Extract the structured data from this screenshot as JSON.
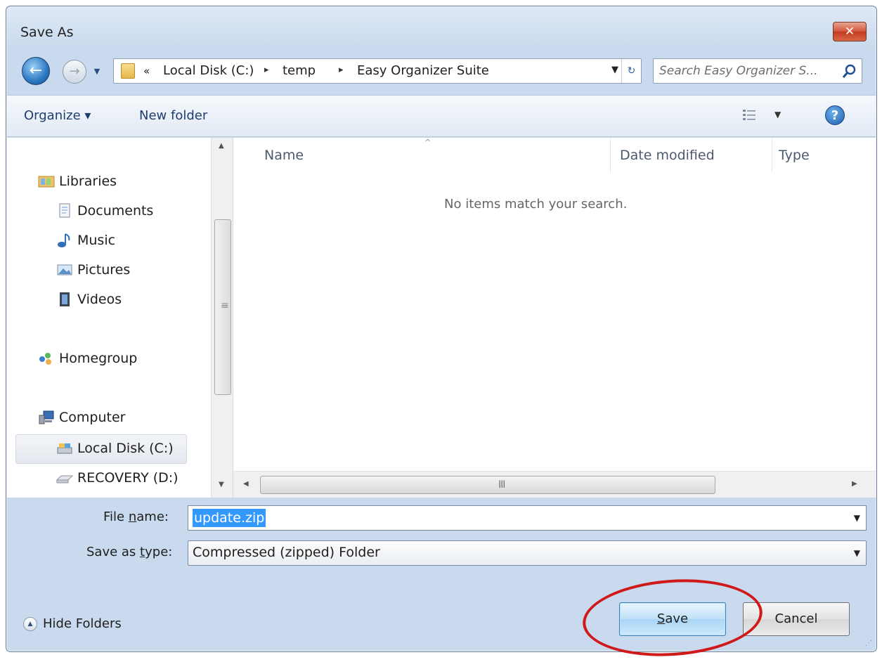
{
  "window": {
    "title": "Save As",
    "close_label": "✕"
  },
  "nav": {
    "back": "←",
    "forward": "→",
    "recent": "▼"
  },
  "address": {
    "overflow": "«",
    "crumbs": [
      "Local Disk (C:)",
      "temp",
      "Easy Organizer Suite"
    ],
    "separator": "▸",
    "dropdown": "▼",
    "refresh": "↻"
  },
  "search": {
    "placeholder": "Search Easy Organizer S..."
  },
  "toolbar": {
    "organize_label": "Organize ▾",
    "new_folder_label": "New folder",
    "view_drop": "▼",
    "help": "?"
  },
  "sidebar": {
    "items": [
      {
        "label": "Libraries",
        "icon": "libraries-icon"
      },
      {
        "label": "Documents",
        "icon": "documents-icon"
      },
      {
        "label": "Music",
        "icon": "music-icon"
      },
      {
        "label": "Pictures",
        "icon": "pictures-icon"
      },
      {
        "label": "Videos",
        "icon": "videos-icon"
      },
      {
        "label": "Homegroup",
        "icon": "homegroup-icon"
      },
      {
        "label": "Computer",
        "icon": "computer-icon"
      },
      {
        "label": "Local Disk (C:)",
        "icon": "local-disk-icon"
      },
      {
        "label": "RECOVERY (D:)",
        "icon": "drive-icon"
      }
    ],
    "selected_index": 7
  },
  "file_list": {
    "columns": [
      "Name",
      "Date modified",
      "Type"
    ],
    "sort_indicator": "^",
    "empty_message": "No items match your search."
  },
  "scroll": {
    "up": "▲",
    "down": "▼",
    "left": "◀",
    "right": "▶",
    "grip_v": "≡",
    "grip_h": "III"
  },
  "form": {
    "file_name_label_pre": "File ",
    "file_name_label_u": "n",
    "file_name_label_post": "ame:",
    "file_name_value": "update.zip",
    "save_type_label_pre": "Save as ",
    "save_type_label_u": "t",
    "save_type_label_post": "ype:",
    "save_type_value": "Compressed (zipped) Folder",
    "dropdown": "▼"
  },
  "footer": {
    "hide_folders_label": "Hide Folders",
    "hide_icon": "▲",
    "save_label_u": "S",
    "save_label_rest": "ave",
    "cancel_label": "Cancel",
    "grip": "⋰"
  },
  "colors": {
    "highlight": "#d01a1a",
    "selection": "#3399ff"
  }
}
